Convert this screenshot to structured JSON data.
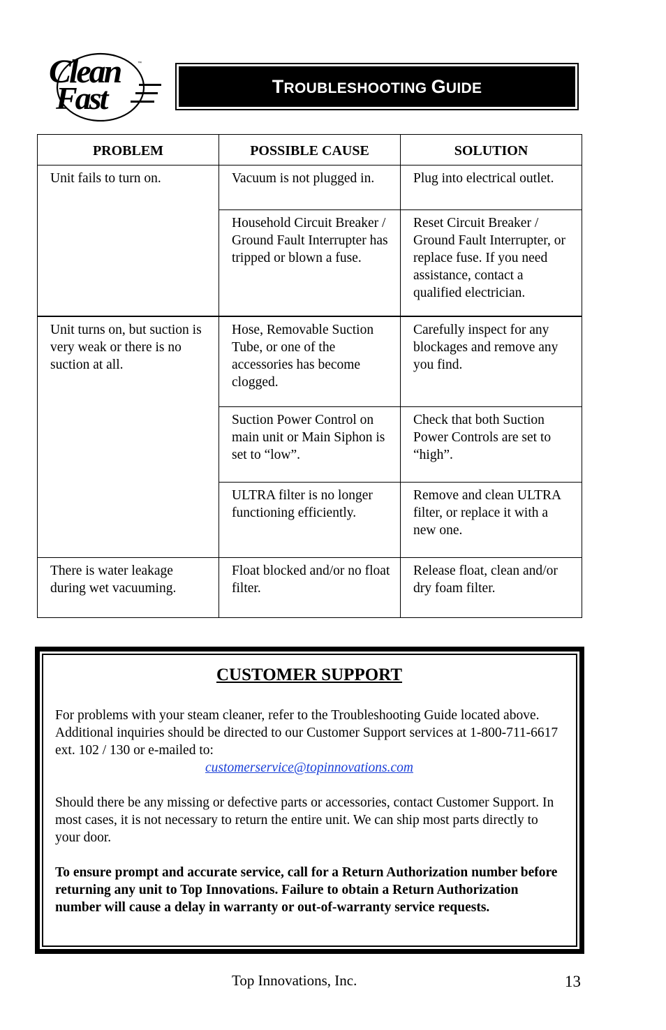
{
  "logo": {
    "line1": "Clean",
    "line2": "Fast",
    "trademark": "™"
  },
  "title": {
    "first_cap_1": "T",
    "rest_1": "roubleshooting",
    "first_cap_2": "G",
    "rest_2": "uide"
  },
  "table": {
    "headers": [
      "PROBLEM",
      "POSSIBLE CAUSE",
      "SOLUTION"
    ],
    "groups": [
      {
        "problem": "Unit fails to turn on.",
        "rows": [
          {
            "cause": "Vacuum is not plugged in.",
            "solution": "Plug into electrical outlet."
          },
          {
            "cause": "Household Circuit Breaker / Ground Fault Interrupter has tripped or blown a fuse.",
            "solution": "Reset Circuit Breaker / Ground Fault Interrupter, or replace fuse.  If you need assistance, contact a qualified electrician."
          }
        ]
      },
      {
        "problem": "Unit turns on, but suction is very weak or there is no suction at all.",
        "rows": [
          {
            "cause": "Hose, Removable Suction Tube, or one of the accessories has become clogged.",
            "solution": "Carefully inspect for any blockages and remove any you find."
          },
          {
            "cause": "Suction Power Control on main unit or Main Siphon is set to “low”.",
            "solution": "Check that both Suction Power Controls are set to “high”."
          },
          {
            "cause": "ULTRA filter is no longer functioning efficiently.",
            "solution": "Remove and clean ULTRA filter, or replace it with a new one."
          }
        ]
      },
      {
        "problem": "There is water leakage during wet vacuuming.",
        "rows": [
          {
            "cause": "Float blocked and/or no float filter.",
            "solution": "Release float, clean and/or dry foam filter."
          }
        ]
      }
    ]
  },
  "support": {
    "title": "CUSTOMER SUPPORT",
    "para1": "For problems with your steam cleaner, refer to the Troubleshooting Guide located above.  Additional inquiries should be directed to our Customer Support services at 1-800-711-6617 ext. 102 / 130 or e-mailed to:",
    "email": "customerservice@topinnovations.com",
    "para2": "Should there be any missing or defective parts or accessories, contact Customer Support.  In most cases, it is not necessary to return the entire unit.  We can ship most parts directly to your door.",
    "para3": "To ensure prompt and accurate service, call for a Return Authorization number before returning any unit to Top Innovations.  Failure to obtain a Return Authorization number will cause a delay in warranty or out-of-warranty service requests."
  },
  "footer": {
    "company": "Top Innovations, Inc.",
    "page_number": "13"
  }
}
